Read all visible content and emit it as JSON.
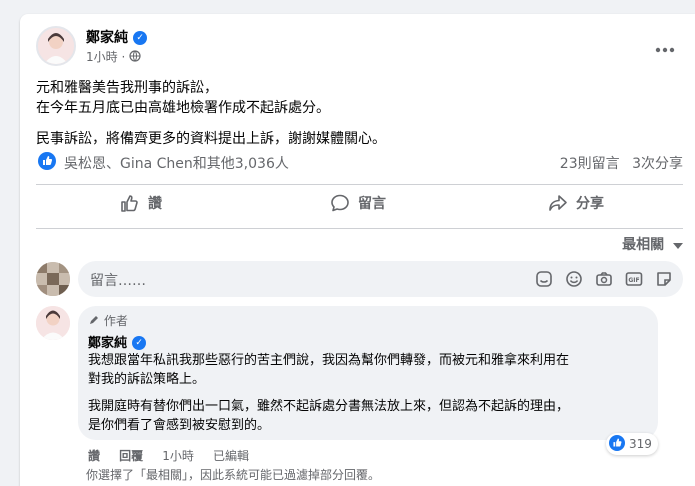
{
  "post": {
    "author": "鄭家純",
    "time": "1小時",
    "lines": [
      "元和雅醫美告我刑事的訴訟，",
      "在今年五月底已由高雄地檢署作成不起訴處分。",
      "民事訴訟，將備齊更多的資料提出上訴，謝謝媒體關心。"
    ],
    "reactions_text": "吳松恩、Gina Chen和其他3,036人",
    "comments_count": "23則留言",
    "shares_count": "3次分享",
    "actions": {
      "like": "讚",
      "comment": "留言",
      "share": "分享"
    }
  },
  "comments_section": {
    "sort_label": "最相關",
    "input_placeholder": "留言……",
    "input_icons": [
      "emoji-icon",
      "sticker-face-icon",
      "camera-icon",
      "gif-icon",
      "sticker-icon"
    ]
  },
  "comment": {
    "author_badge": "作者",
    "author": "鄭家純",
    "paragraphs": [
      [
        "我想跟當年私訊我那些惡行的苦主們說，我因為幫你們轉發，而被元和雅拿來利用在",
        "對我的訴訟策略上。"
      ],
      [
        "我開庭時有替你們出一口氣，雖然不起訴處分書無法放上來，但認為不起訴的理由，",
        "是你們看了會感到被安慰到的。"
      ]
    ],
    "reaction_count": "319",
    "actions": {
      "like": "讚",
      "reply": "回覆",
      "time": "1小時",
      "edited": "已編輯"
    },
    "filter_note": "你選擇了「最相關」，因此系統可能已過濾掉部分回覆。"
  },
  "colors": {
    "brand": "#1877f2",
    "secondary_text": "#65676b",
    "bubble": "#f0f2f5"
  }
}
